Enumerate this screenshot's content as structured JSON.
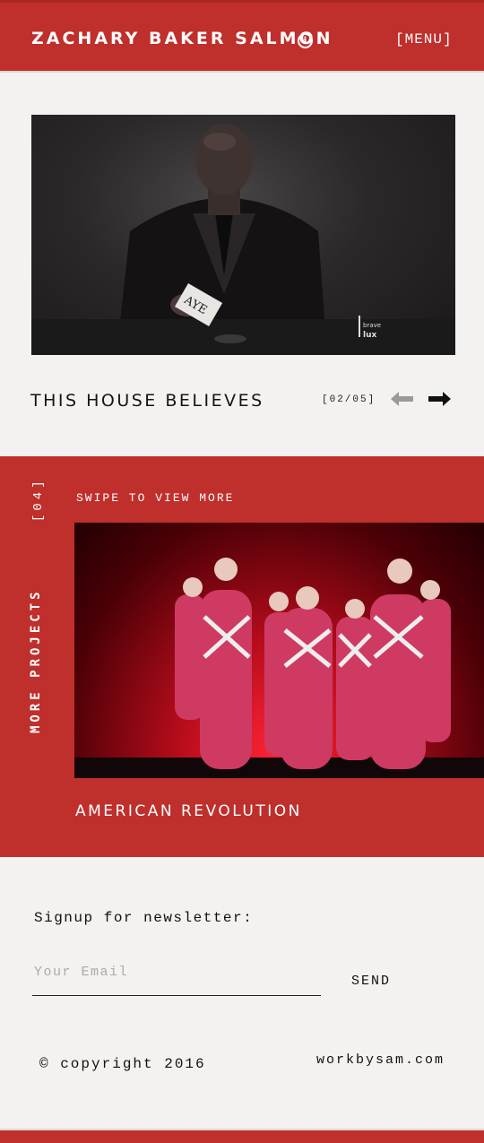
{
  "header": {
    "site_title": "ZACHARY BAKER SALMON",
    "info_glyph": "i",
    "menu_label": "[MENU]"
  },
  "featured": {
    "image_card_text": "AYE",
    "image_logo_top": "brave",
    "image_logo_bottom": "lux",
    "title": "THIS HOUSE BELIEVES",
    "pager": "[02/05]",
    "prev_icon": "arrow-left-icon",
    "next_icon": "arrow-right-icon"
  },
  "more_projects": {
    "section_label": "MORE PROJECTS",
    "count": "[04]",
    "swipe_hint": "SWIPE TO VIEW MORE",
    "card_title": "AMERICAN REVOLUTION"
  },
  "newsletter": {
    "label": "Signup for newsletter:",
    "email_placeholder": "Your Email",
    "send_label": "SEND"
  },
  "footer": {
    "copyright": "© copyright 2016",
    "site_link": "workbysam.com"
  },
  "colors": {
    "brand_red": "#bf2f2c",
    "background": "#f3f2f0"
  }
}
